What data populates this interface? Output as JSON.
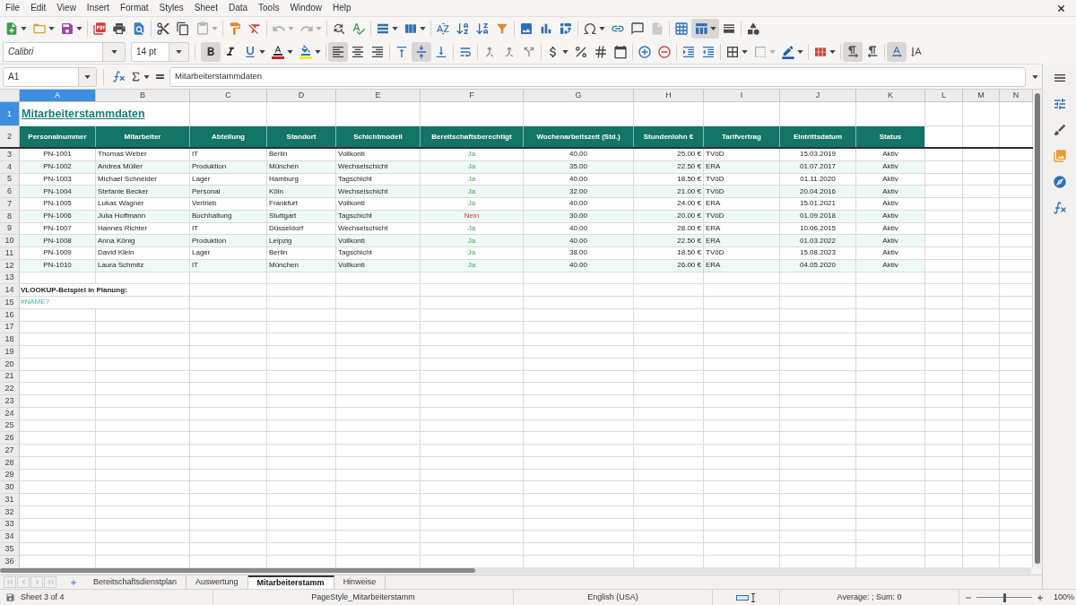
{
  "menu_bar": [
    "File",
    "Edit",
    "View",
    "Insert",
    "Format",
    "Styles",
    "Sheet",
    "Data",
    "Tools",
    "Window",
    "Help"
  ],
  "standard_toolbar": [
    [
      {
        "kind": "new",
        "dropdown": true,
        "active": false,
        "disabled": false
      },
      {
        "kind": "open",
        "dropdown": true,
        "active": false,
        "disabled": false
      },
      {
        "kind": "save",
        "dropdown": true,
        "active": false,
        "disabled": false
      }
    ],
    [
      {
        "kind": "export-pdf",
        "dropdown": false,
        "active": false,
        "disabled": false
      },
      {
        "kind": "print",
        "dropdown": false,
        "active": false,
        "disabled": false
      },
      {
        "kind": "print-preview",
        "dropdown": false,
        "active": false,
        "disabled": false
      }
    ],
    [
      {
        "kind": "cut",
        "dropdown": false,
        "active": false,
        "disabled": false
      },
      {
        "kind": "copy",
        "dropdown": false,
        "active": false,
        "disabled": false
      },
      {
        "kind": "paste",
        "dropdown": true,
        "active": false,
        "disabled": true
      }
    ],
    [
      {
        "kind": "clone",
        "dropdown": false,
        "active": false,
        "disabled": false
      },
      {
        "kind": "clear",
        "dropdown": false,
        "active": false,
        "disabled": false
      }
    ],
    [
      {
        "kind": "undo",
        "dropdown": true,
        "active": false,
        "disabled": true
      },
      {
        "kind": "redo",
        "dropdown": true,
        "active": false,
        "disabled": true
      }
    ],
    [
      {
        "kind": "find",
        "dropdown": false,
        "active": false,
        "disabled": false
      },
      {
        "kind": "spelling",
        "dropdown": false,
        "active": false,
        "disabled": false
      }
    ],
    [
      {
        "kind": "rows",
        "dropdown": true,
        "active": false,
        "disabled": false
      },
      {
        "kind": "columns",
        "dropdown": true,
        "active": false,
        "disabled": false
      }
    ],
    [
      {
        "kind": "sort",
        "dropdown": false,
        "active": false,
        "disabled": false
      },
      {
        "kind": "sort-asc",
        "dropdown": false,
        "active": false,
        "disabled": false
      },
      {
        "kind": "sort-desc",
        "dropdown": false,
        "active": false,
        "disabled": false
      },
      {
        "kind": "autofilter",
        "dropdown": false,
        "active": false,
        "disabled": false
      }
    ],
    [
      {
        "kind": "image",
        "dropdown": false,
        "active": false,
        "disabled": false
      },
      {
        "kind": "chart",
        "dropdown": false,
        "active": false,
        "disabled": false
      },
      {
        "kind": "pivot",
        "dropdown": false,
        "active": false,
        "disabled": false
      }
    ],
    [
      {
        "kind": "special-character",
        "dropdown": true,
        "active": false,
        "disabled": false
      },
      {
        "kind": "hyperlink",
        "dropdown": false,
        "active": false,
        "disabled": false
      },
      {
        "kind": "comment",
        "dropdown": false,
        "active": false,
        "disabled": false
      },
      {
        "kind": "header-footer",
        "dropdown": false,
        "active": false,
        "disabled": true
      }
    ],
    [
      {
        "kind": "print-area",
        "dropdown": false,
        "active": false,
        "disabled": false
      },
      {
        "kind": "freeze",
        "dropdown": true,
        "active": true,
        "disabled": false
      },
      {
        "kind": "split",
        "dropdown": false,
        "active": false,
        "disabled": false
      }
    ],
    [
      {
        "kind": "shapes",
        "dropdown": false,
        "active": false,
        "disabled": false
      }
    ]
  ],
  "formatting_toolbar": {
    "font_name": "Calibri",
    "font_size": "14 pt",
    "groups": [
      [
        {
          "kind": "bold",
          "dropdown": false,
          "active": true,
          "disabled": false
        },
        {
          "kind": "italic",
          "dropdown": false,
          "active": false,
          "disabled": false
        },
        {
          "kind": "underline",
          "dropdown": true,
          "active": false,
          "disabled": false
        },
        {
          "kind": "font-color",
          "dropdown": true,
          "active": false,
          "disabled": false
        },
        {
          "kind": "highlight",
          "dropdown": true,
          "active": false,
          "disabled": false
        }
      ],
      [
        {
          "kind": "align-left",
          "dropdown": false,
          "active": true,
          "disabled": false
        },
        {
          "kind": "align-center",
          "dropdown": false,
          "active": false,
          "disabled": false
        },
        {
          "kind": "align-right",
          "dropdown": false,
          "active": false,
          "disabled": false
        }
      ],
      [
        {
          "kind": "align-top",
          "dropdown": false,
          "active": false,
          "disabled": false
        },
        {
          "kind": "align-middle",
          "dropdown": false,
          "active": true,
          "disabled": false
        },
        {
          "kind": "align-bottom",
          "dropdown": false,
          "active": false,
          "disabled": false
        }
      ],
      [
        {
          "kind": "wrap",
          "dropdown": false,
          "active": false,
          "disabled": false
        }
      ],
      [
        {
          "kind": "merge-center",
          "dropdown": false,
          "active": false,
          "disabled": false
        },
        {
          "kind": "merge",
          "dropdown": false,
          "active": false,
          "disabled": false
        },
        {
          "kind": "unmerge",
          "dropdown": false,
          "active": false,
          "disabled": false
        }
      ],
      [
        {
          "kind": "currency",
          "dropdown": true,
          "active": false,
          "disabled": false
        },
        {
          "kind": "percent",
          "dropdown": false,
          "active": false,
          "disabled": false
        },
        {
          "kind": "number",
          "dropdown": false,
          "active": false,
          "disabled": false
        },
        {
          "kind": "date",
          "dropdown": false,
          "active": false,
          "disabled": false
        }
      ],
      [
        {
          "kind": "add-decimal",
          "dropdown": false,
          "active": false,
          "disabled": false
        },
        {
          "kind": "delete-decimal",
          "dropdown": false,
          "active": false,
          "disabled": false
        }
      ],
      [
        {
          "kind": "indent-increase",
          "dropdown": false,
          "active": false,
          "disabled": false
        },
        {
          "kind": "indent-decrease",
          "dropdown": false,
          "active": false,
          "disabled": false
        }
      ],
      [
        {
          "kind": "borders",
          "dropdown": true,
          "active": false,
          "disabled": false
        },
        {
          "kind": "border-style",
          "dropdown": true,
          "active": false,
          "disabled": true
        },
        {
          "kind": "border-color",
          "dropdown": true,
          "active": false,
          "disabled": false
        }
      ],
      [
        {
          "kind": "conditional",
          "dropdown": true,
          "active": false,
          "disabled": false
        }
      ],
      [
        {
          "kind": "ltr",
          "dropdown": false,
          "active": true,
          "disabled": false
        },
        {
          "kind": "rtl",
          "dropdown": false,
          "active": false,
          "disabled": false
        }
      ],
      [
        {
          "kind": "text-horizontal",
          "dropdown": false,
          "active": true,
          "disabled": false
        },
        {
          "kind": "text-vertical",
          "dropdown": false,
          "active": false,
          "disabled": false
        }
      ]
    ]
  },
  "formula_bar": {
    "name_box": "A1",
    "content": "Mitarbeiterstammdaten"
  },
  "sheet": {
    "columns": [
      {
        "label": "A",
        "selected": true
      },
      {
        "label": "B",
        "selected": false
      },
      {
        "label": "C",
        "selected": false
      },
      {
        "label": "D",
        "selected": false
      },
      {
        "label": "E",
        "selected": false
      },
      {
        "label": "F",
        "selected": false
      },
      {
        "label": "G",
        "selected": false
      },
      {
        "label": "H",
        "selected": false
      },
      {
        "label": "I",
        "selected": false
      },
      {
        "label": "J",
        "selected": false
      },
      {
        "label": "K",
        "selected": false
      },
      {
        "label": "L",
        "selected": false
      },
      {
        "label": "M",
        "selected": false
      },
      {
        "label": "N",
        "selected": false
      }
    ],
    "row_headers": [
      {
        "label": "1",
        "selected": true
      },
      {
        "label": "2",
        "selected": false
      },
      {
        "label": "3",
        "selected": false
      },
      {
        "label": "4",
        "selected": false
      },
      {
        "label": "5",
        "selected": false
      },
      {
        "label": "6",
        "selected": false
      },
      {
        "label": "7",
        "selected": false
      },
      {
        "label": "8",
        "selected": false
      },
      {
        "label": "9",
        "selected": false
      },
      {
        "label": "10",
        "selected": false
      },
      {
        "label": "11",
        "selected": false
      },
      {
        "label": "12",
        "selected": false
      },
      {
        "label": "13",
        "selected": false
      },
      {
        "label": "14",
        "selected": false
      },
      {
        "label": "15",
        "selected": false
      },
      {
        "label": "16",
        "selected": false
      },
      {
        "label": "17",
        "selected": false
      },
      {
        "label": "18",
        "selected": false
      },
      {
        "label": "19",
        "selected": false
      },
      {
        "label": "20",
        "selected": false
      },
      {
        "label": "21",
        "selected": false
      },
      {
        "label": "22",
        "selected": false
      },
      {
        "label": "23",
        "selected": false
      },
      {
        "label": "24",
        "selected": false
      },
      {
        "label": "25",
        "selected": false
      },
      {
        "label": "26",
        "selected": false
      },
      {
        "label": "27",
        "selected": false
      },
      {
        "label": "28",
        "selected": false
      },
      {
        "label": "29",
        "selected": false
      },
      {
        "label": "30",
        "selected": false
      },
      {
        "label": "31",
        "selected": false
      },
      {
        "label": "32",
        "selected": false
      },
      {
        "label": "33",
        "selected": false
      },
      {
        "label": "34",
        "selected": false
      },
      {
        "label": "35",
        "selected": false
      },
      {
        "label": "36",
        "selected": false
      }
    ],
    "title": "Mitarbeiterstammdaten",
    "header": [
      "Personalnummer",
      "Mitarbeiter",
      "Abteilung",
      "Standort",
      "Schichtmodell",
      "Bereitschaftsberechtigt",
      "Wochenarbeitszeit (Std.)",
      "Stundenlohn €",
      "Tarifvertrag",
      "Eintrittsdatum",
      "Status"
    ],
    "rows": [
      {
        "cells": [
          "PN-1001",
          "Thomas Weber",
          "IT",
          "Berlin",
          "Vollkonti",
          {
            "text": "Ja",
            "kind": "positive"
          },
          "40.00",
          "25.00 €",
          "TVöD",
          "15.03.2019",
          "Aktiv"
        ]
      },
      {
        "cells": [
          "PN-1002",
          "Andrea Müller",
          "Produktion",
          "München",
          "Wechselschicht",
          {
            "text": "Ja",
            "kind": "positive"
          },
          "35.00",
          "22.50 €",
          "ERA",
          "01.07.2017",
          "Aktiv"
        ]
      },
      {
        "cells": [
          "PN-1003",
          "Michael Schneider",
          "Lager",
          "Hamburg",
          "Tagschicht",
          {
            "text": "Ja",
            "kind": "positive"
          },
          "40.00",
          "18.50 €",
          "TVöD",
          "01.11.2020",
          "Aktiv"
        ]
      },
      {
        "cells": [
          "PN-1004",
          "Stefanie Becker",
          "Personal",
          "Köln",
          "Wechselschicht",
          {
            "text": "Ja",
            "kind": "positive"
          },
          "32.00",
          "21.00 €",
          "TVöD",
          "20.04.2016",
          "Aktiv"
        ]
      },
      {
        "cells": [
          "PN-1005",
          "Lukas Wagner",
          "Vertrieb",
          "Frankfurt",
          "Vollkonti",
          {
            "text": "Ja",
            "kind": "positive"
          },
          "40.00",
          "24.00 €",
          "ERA",
          "15.01.2021",
          "Aktiv"
        ]
      },
      {
        "cells": [
          "PN-1006",
          "Julia Hoffmann",
          "Buchhaltung",
          "Stuttgart",
          "Tagschicht",
          {
            "text": "Nein",
            "kind": "negative"
          },
          "30.00",
          "20.00 €",
          "TVöD",
          "01.09.2018",
          "Aktiv"
        ]
      },
      {
        "cells": [
          "PN-1007",
          "Hannes Richter",
          "IT",
          "Düsseldorf",
          "Wechselschicht",
          {
            "text": "Ja",
            "kind": "positive"
          },
          "40.00",
          "28.00 €",
          "ERA",
          "10.06.2015",
          "Aktiv"
        ]
      },
      {
        "cells": [
          "PN-1008",
          "Anna König",
          "Produktion",
          "Leipzig",
          "Vollkonti",
          {
            "text": "Ja",
            "kind": "positive"
          },
          "40.00",
          "22.50 €",
          "ERA",
          "01.03.2022",
          "Aktiv"
        ]
      },
      {
        "cells": [
          "PN-1009",
          "David Klein",
          "Lager",
          "Berlin",
          "Tagschicht",
          {
            "text": "Ja",
            "kind": "positive"
          },
          "38.00",
          "18.50 €",
          "TVöD",
          "15.08.2023",
          "Aktiv"
        ]
      },
      {
        "cells": [
          "PN-1010",
          "Laura Schmitz",
          "IT",
          "München",
          "Vollkonti",
          {
            "text": "Ja",
            "kind": "positive"
          },
          "40.00",
          "26.00 €",
          "ERA",
          "04.05.2020",
          "Aktiv"
        ]
      }
    ],
    "note": "VLOOKUP-Beispiel in Planung:",
    "error": "#NAME?"
  },
  "sheet_navigation": [
    {
      "kind": "first",
      "disabled": true
    },
    {
      "kind": "previous",
      "disabled": true
    },
    {
      "kind": "next",
      "disabled": true
    },
    {
      "kind": "last",
      "disabled": true
    }
  ],
  "sheet_tabs": [
    {
      "label": "Bereitschaftsdienstplan",
      "selected": false
    },
    {
      "label": "Auswertung",
      "selected": false
    },
    {
      "label": "Mitarbeiterstamm",
      "selected": true
    },
    {
      "label": "Hinweise",
      "selected": false
    }
  ],
  "status_bar": {
    "sheet_position": "Sheet 3 of 4",
    "page_style": "PageStyle_Mitarbeiterstamm",
    "language": "English (USA)",
    "selection_summary": "Average: ; Sum: 0",
    "zoom": {
      "level": 0.5,
      "reading": "100%"
    }
  }
}
